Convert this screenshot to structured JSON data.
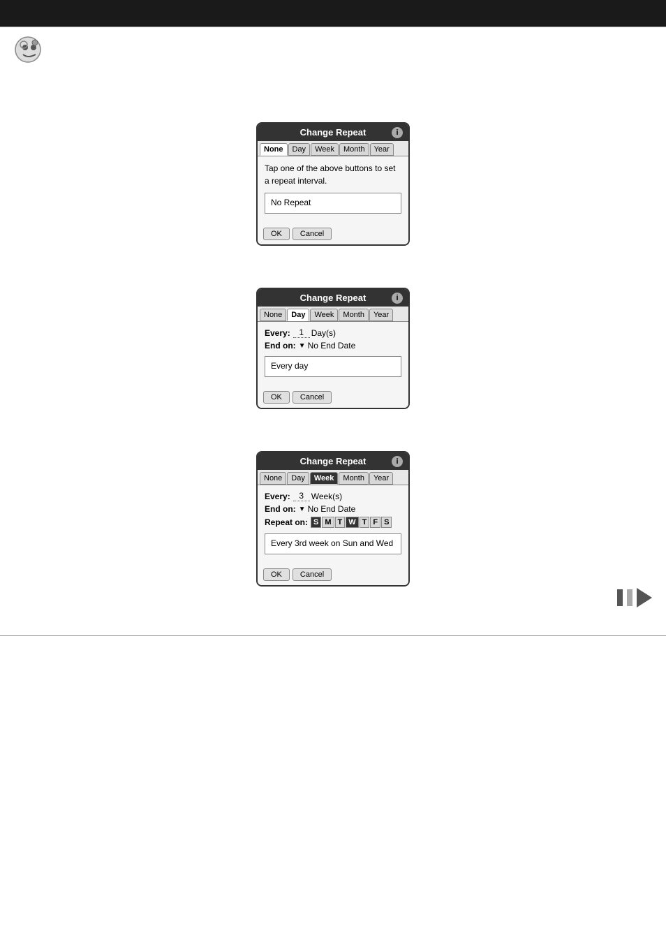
{
  "header": {
    "bg_color": "#1a1a1a"
  },
  "dialogs": [
    {
      "id": "dialog1",
      "title": "Change Repeat",
      "tabs": [
        "None",
        "Day",
        "Week",
        "Month",
        "Year"
      ],
      "active_tab": "None",
      "body_text": "Tap one of the above buttons to set a repeat interval.",
      "preview_text": "No Repeat",
      "ok_label": "OK",
      "cancel_label": "Cancel",
      "type": "none"
    },
    {
      "id": "dialog2",
      "title": "Change Repeat",
      "tabs": [
        "None",
        "Day",
        "Week",
        "Month",
        "Year"
      ],
      "active_tab": "Day",
      "every_label": "Every:",
      "every_value": "1",
      "every_unit": "Day(s)",
      "end_on_label": "End on:",
      "end_on_value": "No End Date",
      "preview_text": "Every day",
      "ok_label": "OK",
      "cancel_label": "Cancel",
      "type": "day"
    },
    {
      "id": "dialog3",
      "title": "Change Repeat",
      "tabs": [
        "None",
        "Day",
        "Week",
        "Month",
        "Year"
      ],
      "active_tab": "Week",
      "every_label": "Every:",
      "every_value": "3",
      "every_unit": "Week(s)",
      "end_on_label": "End on:",
      "end_on_value": "No End Date",
      "repeat_on_label": "Repeat on:",
      "days": [
        {
          "label": "S",
          "active": true
        },
        {
          "label": "M",
          "active": false
        },
        {
          "label": "T",
          "active": false
        },
        {
          "label": "W",
          "active": true
        },
        {
          "label": "T",
          "active": false
        },
        {
          "label": "F",
          "active": false
        },
        {
          "label": "S",
          "active": false
        }
      ],
      "preview_text": "Every 3rd week on Sun and Wed",
      "ok_label": "OK",
      "cancel_label": "Cancel",
      "type": "week"
    }
  ],
  "nav": {
    "page_indicator": "II",
    "arrow_label": "next"
  }
}
